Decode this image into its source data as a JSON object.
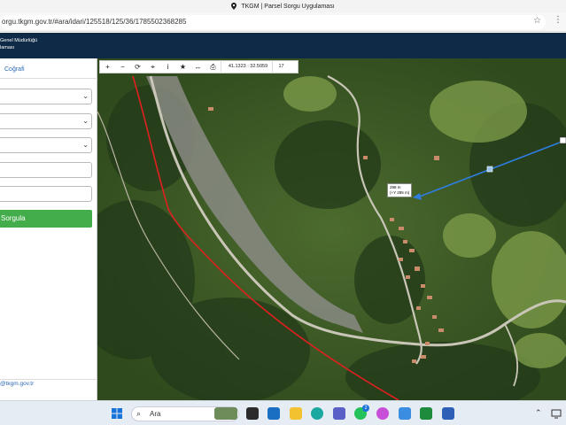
{
  "browser": {
    "tab_title": "TKGM | Parsel Sorgu Uygulaması",
    "url": "orgu.tkgm.gov.tr/#ara/idari/125518/125/36/1785502368285"
  },
  "site_header": {
    "line1": "Genel Müdürlüğü",
    "line2": "laması"
  },
  "left_panel": {
    "tab_label": "Coğrafi",
    "query_button": "Sorgula",
    "footer_link": "@tkgm.gov.tr"
  },
  "map_toolbar": {
    "coordinates": "41.1323 : 32.5059",
    "zoom_level": "17"
  },
  "measure": {
    "line1": "298 m",
    "line2": "(+Y 285 m)"
  },
  "taskbar": {
    "search_placeholder": "Ara",
    "whatsapp_badge": "2"
  },
  "colors": {
    "header_bg": "#0e2a47",
    "sorgula_bg": "#42ad4a",
    "parcel_line": "#e02020",
    "measure_line": "#2f7de0"
  }
}
